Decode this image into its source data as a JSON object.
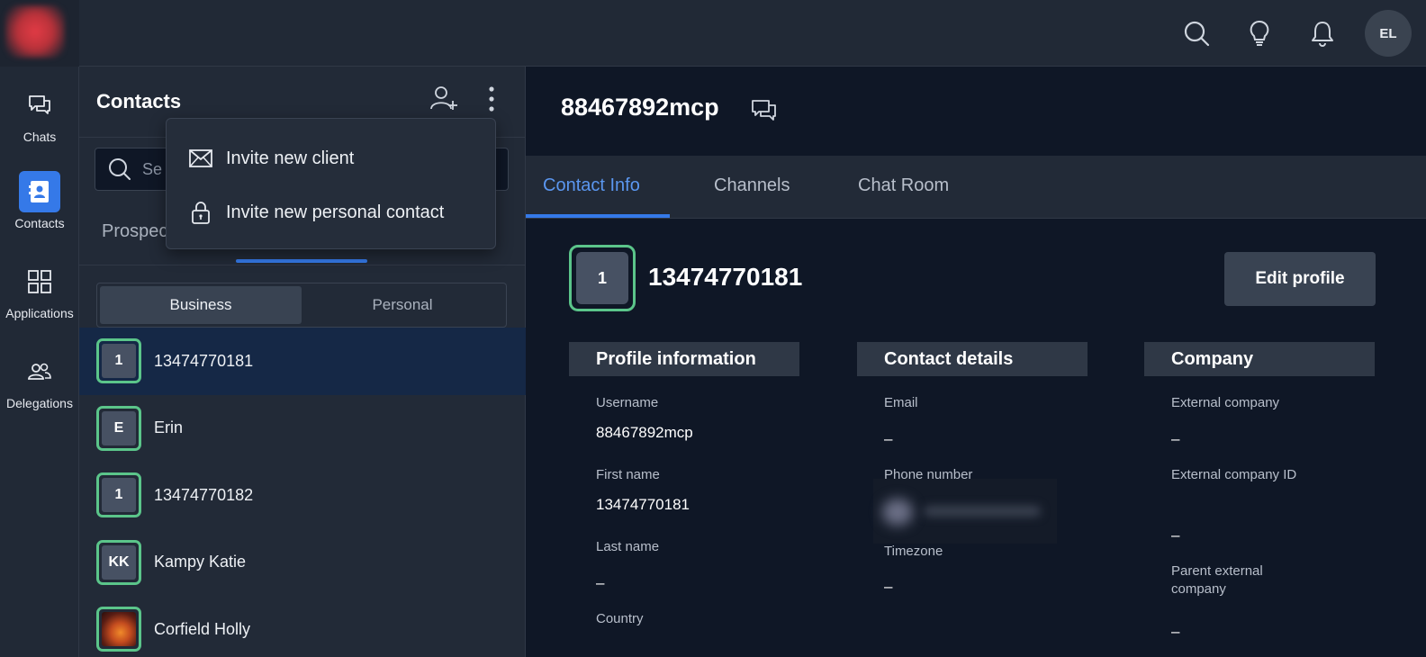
{
  "topbar": {
    "avatar_initials": "EL",
    "icons": [
      "search-icon",
      "lightbulb-icon",
      "bell-icon"
    ]
  },
  "nav": {
    "items": [
      {
        "label": "Chats",
        "icon": "chat-icon"
      },
      {
        "label": "Contacts",
        "icon": "contacts-icon",
        "active": true
      },
      {
        "label": "Applications",
        "icon": "grid-icon"
      },
      {
        "label": "Delegations",
        "icon": "users-icon"
      }
    ]
  },
  "contacts": {
    "title": "Contacts",
    "search_placeholder": "Se",
    "category_tab": "Prospec",
    "segments": [
      "Business",
      "Personal"
    ],
    "list": [
      {
        "initials": "1",
        "name": "13474770181",
        "selected": true
      },
      {
        "initials": "E",
        "name": "Erin"
      },
      {
        "initials": "1",
        "name": "13474770182"
      },
      {
        "initials": "KK",
        "name": "Kampy Katie"
      },
      {
        "initials": "",
        "name": "Corfield Holly",
        "photo": true
      }
    ]
  },
  "menu": {
    "items": [
      {
        "label": "Invite new client",
        "icon": "envelope-icon"
      },
      {
        "label": "Invite new personal contact",
        "icon": "lock-icon"
      }
    ]
  },
  "detail": {
    "title": "88467892mcp",
    "tabs": [
      "Contact Info",
      "Channels",
      "Chat Room"
    ],
    "avatar_initials": "1",
    "name": "13474770181",
    "edit_button": "Edit profile",
    "sections": {
      "profile": {
        "heading": "Profile information",
        "fields": [
          {
            "label": "Username",
            "value": "88467892mcp"
          },
          {
            "label": "First name",
            "value": "13474770181"
          },
          {
            "label": "Last name",
            "value": "–"
          },
          {
            "label": "Country",
            "value": ""
          }
        ]
      },
      "contact": {
        "heading": "Contact details",
        "fields": [
          {
            "label": "Email",
            "value": "–"
          },
          {
            "label": "Phone number",
            "value": ""
          },
          {
            "label": "Timezone",
            "value": "–"
          }
        ]
      },
      "company": {
        "heading": "Company",
        "fields": [
          {
            "label": "External company",
            "value": "–"
          },
          {
            "label": "External company ID",
            "value": "–"
          },
          {
            "label": "Parent external company",
            "value": "–"
          }
        ]
      }
    }
  },
  "colors": {
    "accent": "#3579e8",
    "online_border": "#5bc58a",
    "selected_row": "#152846"
  }
}
